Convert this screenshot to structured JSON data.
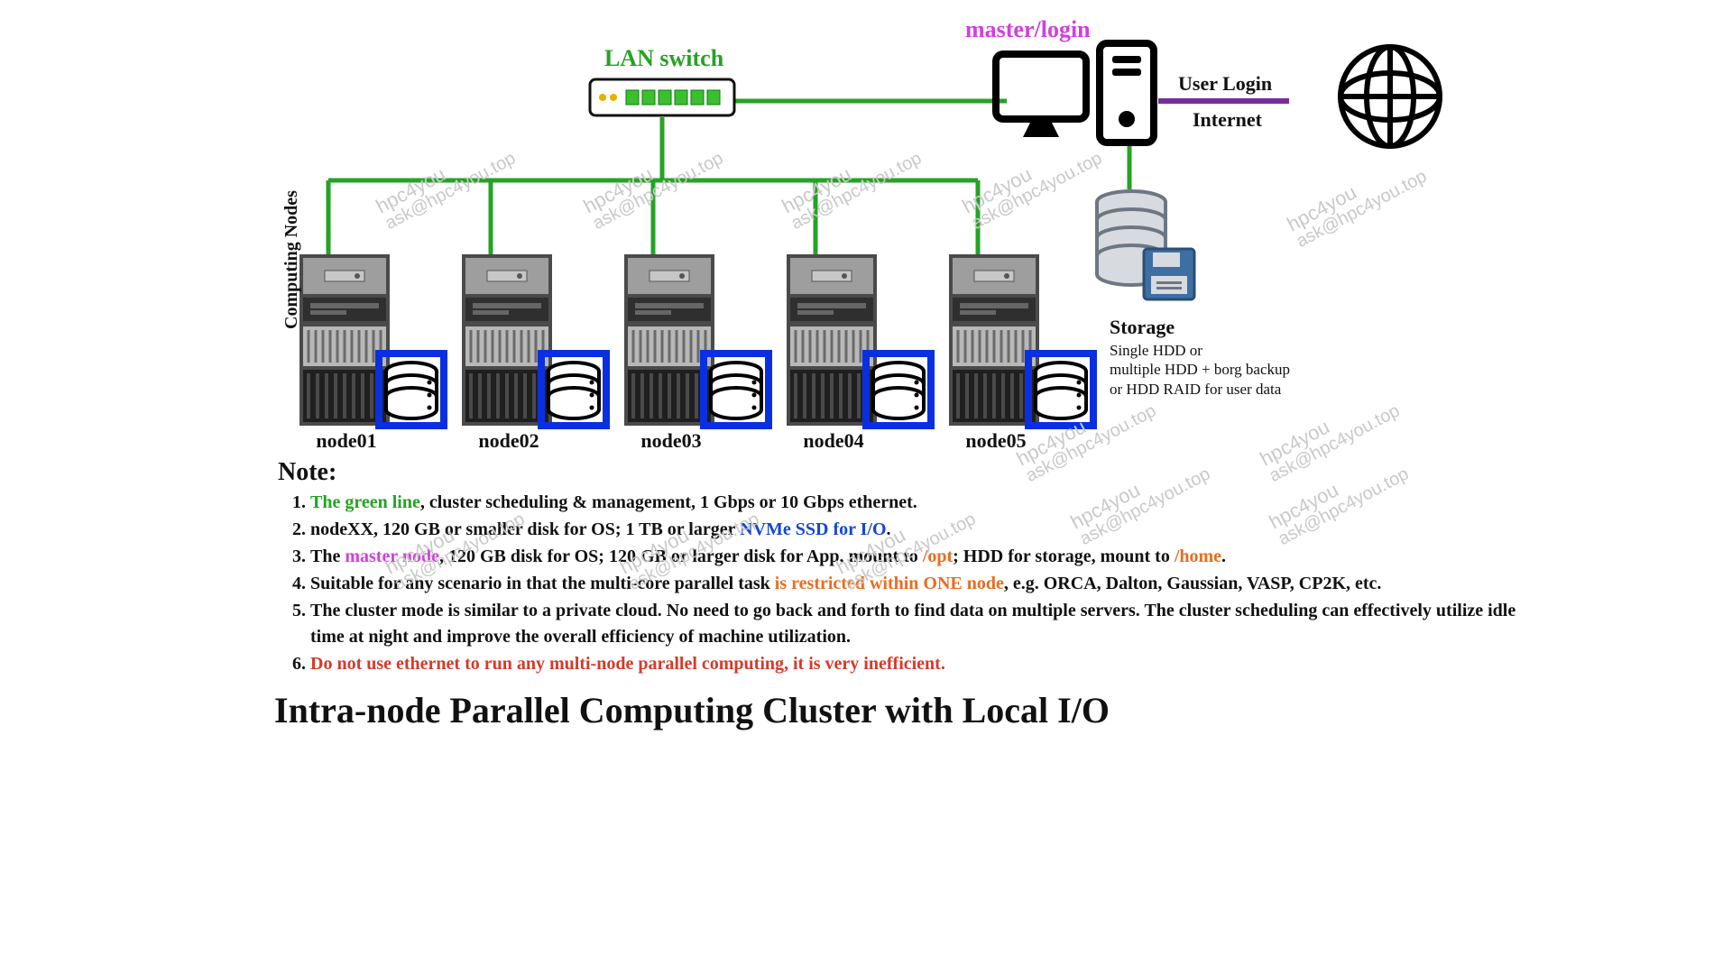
{
  "labels": {
    "lan_switch": "LAN switch",
    "master_login": "master/login",
    "user_login": "User Login",
    "internet": "Internet",
    "computing_nodes_axis": "Computing Nodes",
    "storage_title": "Storage",
    "storage_body1": "Single HDD or",
    "storage_body2": "multiple HDD + borg backup",
    "storage_body3": "or HDD RAID for user data"
  },
  "nodes": [
    {
      "id": "node01",
      "label": "node01"
    },
    {
      "id": "node02",
      "label": "node02"
    },
    {
      "id": "node03",
      "label": "node03"
    },
    {
      "id": "node04",
      "label": "node04"
    },
    {
      "id": "node05",
      "label": "node05"
    }
  ],
  "connections": {
    "green_line_meaning": "cluster scheduling & management, 1 Gbps or 10 Gbps ethernet",
    "purple_line_meaning": "User Login / Internet"
  },
  "notes_heading": "Note:",
  "notes": [
    [
      {
        "t": "The green line",
        "c": "c-green"
      },
      {
        "t": ", cluster scheduling & management, 1 Gbps or 10 Gbps ethernet."
      }
    ],
    [
      {
        "t": "nodeXX, 120 GB or smaller disk for OS; 1 TB or larger "
      },
      {
        "t": "NVMe SSD for I/O",
        "c": "c-blue"
      },
      {
        "t": "."
      }
    ],
    [
      {
        "t": "The "
      },
      {
        "t": "master node",
        "c": "c-mag"
      },
      {
        "t": ", 120 GB disk for OS; 120 GB or larger disk for App, mount to "
      },
      {
        "t": "/opt",
        "c": "c-orange"
      },
      {
        "t": "; HDD for storage, mount to "
      },
      {
        "t": "/home",
        "c": "c-orange"
      },
      {
        "t": "."
      }
    ],
    [
      {
        "t": "Suitable for any scenario in that the multi-core parallel task "
      },
      {
        "t": "is restricted within ONE node",
        "c": "c-orange"
      },
      {
        "t": ", e.g. ORCA, Dalton, Gaussian, VASP, CP2K, etc."
      }
    ],
    [
      {
        "t": "The cluster mode is similar to a private cloud. No need to go back and forth to find data on multiple servers. The cluster scheduling can effectively utilize idle time at night and improve the overall efficiency of machine utilization."
      }
    ],
    [
      {
        "t": "Do not use ethernet to run any multi-node parallel computing, it is very inefficient.",
        "c": "c-red"
      }
    ]
  ],
  "title": "Intra-node Parallel Computing Cluster with Local I/O",
  "watermark": {
    "line1": "hpc4you",
    "line2": "ask@hpc4you.top"
  },
  "colors": {
    "green_line": "#25a324",
    "purple_line": "#7a2b9e",
    "blue_box": "#0a2fe0"
  }
}
